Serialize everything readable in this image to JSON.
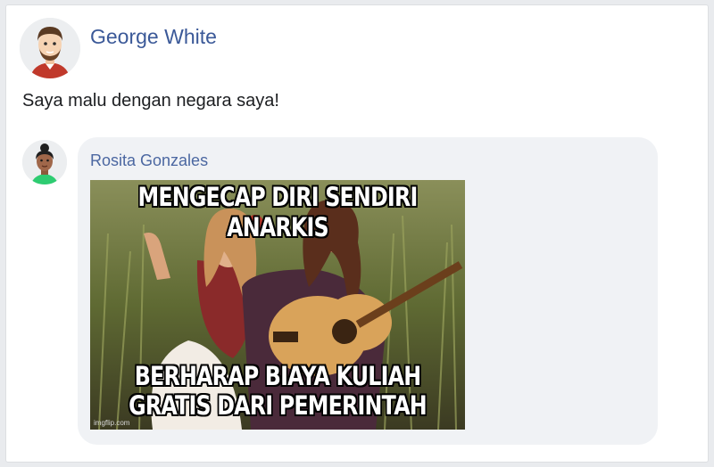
{
  "post": {
    "author": "George White",
    "text": "Saya malu dengan negara saya!"
  },
  "comment": {
    "author": "Rosita Gonzales",
    "meme": {
      "top_text": "MENGECAP DIRI SENDIRI ANARKIS",
      "bottom_text": "BERHARAP BIAYA KULIAH\nGRATIS DARI PEMERINTAH",
      "watermark": "imgflip.com"
    }
  },
  "colors": {
    "link_blue": "#3b5998",
    "bubble_bg": "#f0f2f5"
  }
}
